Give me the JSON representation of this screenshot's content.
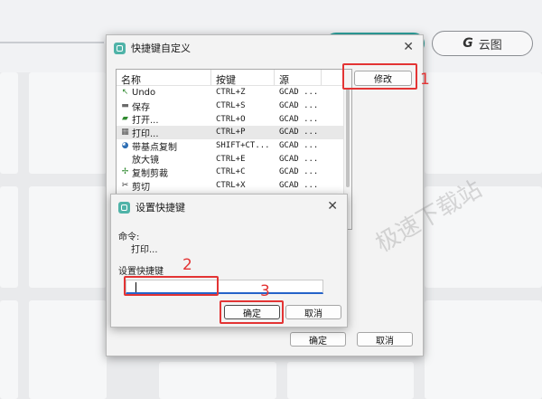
{
  "cloud_button": {
    "icon_letter": "G",
    "label": "云图"
  },
  "main_dialog": {
    "title": "快捷键自定义",
    "columns": [
      "名称",
      "按键",
      "源"
    ],
    "rows": [
      {
        "icon": "↖",
        "icon_color": "#2f8a2f",
        "name": "Undo",
        "keys": "CTRL+Z",
        "source": "GCAD ..."
      },
      {
        "icon": "▬",
        "icon_color": "#6a6a6a",
        "name": "保存",
        "keys": "CTRL+S",
        "source": "GCAD ..."
      },
      {
        "icon": "▰",
        "icon_color": "#2f8a2f",
        "name": "打开...",
        "keys": "CTRL+O",
        "source": "GCAD ..."
      },
      {
        "icon": "▦",
        "icon_color": "#555555",
        "name": "打印...",
        "keys": "CTRL+P",
        "source": "GCAD ..."
      },
      {
        "icon": "◕",
        "icon_color": "#2f6fb4",
        "name": "带基点复制",
        "keys": "SHIFT+CT...",
        "source": "GCAD ..."
      },
      {
        "icon": "",
        "icon_color": "#555555",
        "name": "放大镜",
        "keys": "CTRL+E",
        "source": "GCAD ..."
      },
      {
        "icon": "✢",
        "icon_color": "#2f8a2f",
        "name": "复制剪裁",
        "keys": "CTRL+C",
        "source": "GCAD ..."
      },
      {
        "icon": "✂",
        "icon_color": "#333333",
        "name": "剪切",
        "keys": "CTRL+X",
        "source": "GCAD ..."
      }
    ],
    "modify_label": "修改",
    "ok_label": "确定",
    "cancel_label": "取消"
  },
  "sub_dialog": {
    "title": "设置快捷键",
    "command_label": "命令:",
    "command_value": "打印...",
    "shortcut_label": "设置快捷键",
    "shortcut_value": "",
    "ok_label": "确定",
    "cancel_label": "取消"
  },
  "annotations": {
    "step1": "1",
    "step2": "2",
    "step3": "3",
    "color": "#e33434"
  },
  "watermark": "极速下载站"
}
